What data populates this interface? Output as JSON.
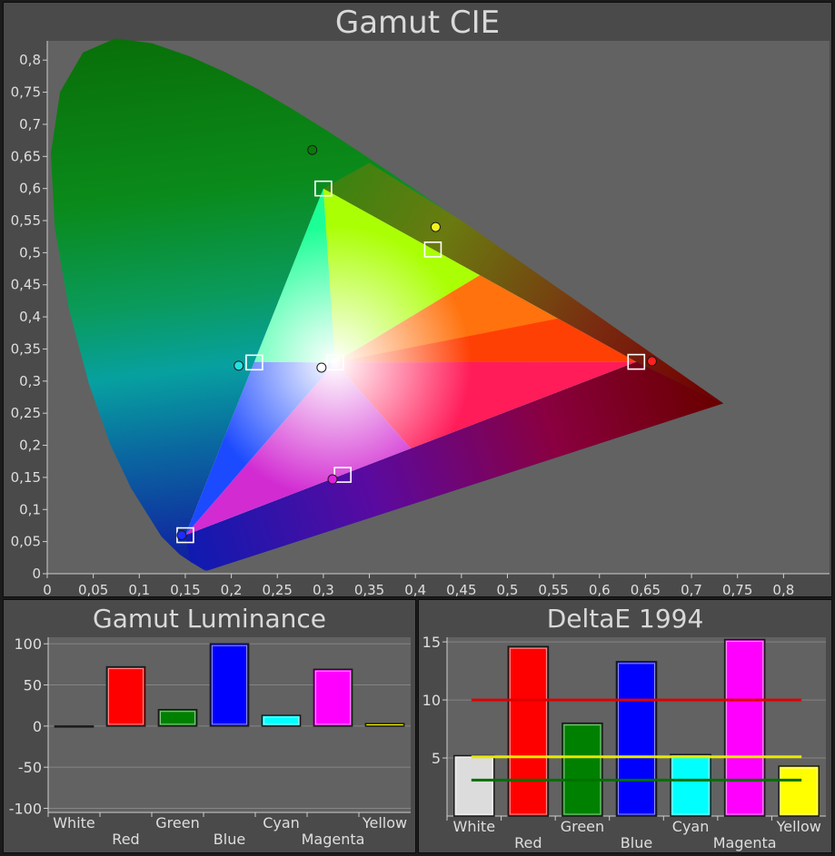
{
  "chart_data": [
    {
      "type": "scatter",
      "title": "Gamut CIE",
      "xlim": [
        0,
        0.85
      ],
      "ylim": [
        0,
        0.83
      ],
      "x_ticks": [
        "0",
        "0,05",
        "0,1",
        "0,15",
        "0,2",
        "0,25",
        "0,3",
        "0,35",
        "0,4",
        "0,45",
        "0,5",
        "0,55",
        "0,6",
        "0,65",
        "0,7",
        "0,75",
        "0,8"
      ],
      "y_ticks": [
        "0",
        "0,05",
        "0,1",
        "0,15",
        "0,2",
        "0,25",
        "0,3",
        "0,35",
        "0,4",
        "0,45",
        "0,5",
        "0,55",
        "0,6",
        "0,65",
        "0,7",
        "0,75",
        "0,8"
      ],
      "target_points": [
        {
          "name": "Red",
          "x": 0.64,
          "y": 0.33
        },
        {
          "name": "Green",
          "x": 0.3,
          "y": 0.6
        },
        {
          "name": "Blue",
          "x": 0.15,
          "y": 0.06
        },
        {
          "name": "White",
          "x": 0.3127,
          "y": 0.329
        },
        {
          "name": "Cyan",
          "x": 0.225,
          "y": 0.329
        },
        {
          "name": "Magenta",
          "x": 0.321,
          "y": 0.154
        },
        {
          "name": "Yellow",
          "x": 0.419,
          "y": 0.505
        }
      ],
      "measured_points": [
        {
          "name": "Red",
          "x": 0.657,
          "y": 0.331,
          "color": "#ff2020"
        },
        {
          "name": "Green",
          "x": 0.288,
          "y": 0.66,
          "color": "#0a7a0a"
        },
        {
          "name": "Blue",
          "x": 0.146,
          "y": 0.06,
          "color": "#1a2cff"
        },
        {
          "name": "White",
          "x": 0.298,
          "y": 0.321,
          "color": "#ffffff"
        },
        {
          "name": "Cyan",
          "x": 0.208,
          "y": 0.324,
          "color": "#22e0e0"
        },
        {
          "name": "Magenta",
          "x": 0.31,
          "y": 0.147,
          "color": "#e020e0"
        },
        {
          "name": "Yellow",
          "x": 0.422,
          "y": 0.54,
          "color": "#f0f020"
        }
      ]
    },
    {
      "type": "bar",
      "title": "Gamut Luminance",
      "categories": [
        "White",
        "Red",
        "Green",
        "Blue",
        "Cyan",
        "Magenta",
        "Yellow"
      ],
      "values": [
        0,
        72,
        20,
        100,
        13,
        69,
        3
      ],
      "colors": [
        "#e0e0e0",
        "#ff0000",
        "#008000",
        "#0000ff",
        "#00ffff",
        "#ff00ff",
        "#ffff00"
      ],
      "ylim": [
        -105,
        108
      ],
      "y_ticks": [
        100,
        50,
        0,
        -50,
        -100
      ]
    },
    {
      "type": "bar",
      "title": "DeltaE 1994",
      "categories": [
        "White",
        "Red",
        "Green",
        "Blue",
        "Cyan",
        "Magenta",
        "Yellow"
      ],
      "values": [
        5.2,
        14.6,
        8.0,
        13.3,
        5.3,
        15.2,
        4.3
      ],
      "colors": [
        "#dcdcdc",
        "#ff0000",
        "#008000",
        "#0000ff",
        "#00ffff",
        "#ff00ff",
        "#ffff00"
      ],
      "ylim": [
        0,
        15.4
      ],
      "y_ticks": [
        15,
        10,
        5
      ],
      "reference_lines": [
        {
          "value": 10,
          "color": "#e00000"
        },
        {
          "value": 5.1,
          "color": "#e8e800"
        },
        {
          "value": 3.1,
          "color": "#007000"
        }
      ]
    }
  ]
}
